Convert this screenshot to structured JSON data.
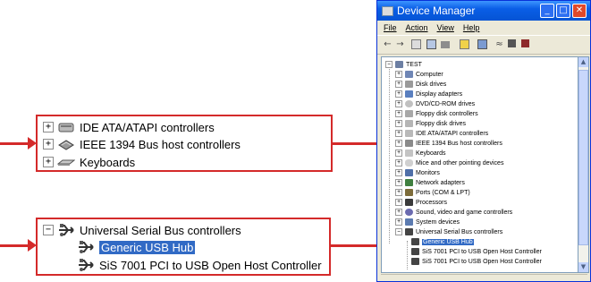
{
  "zoom_top": {
    "rows": [
      {
        "expander": "+",
        "label": "IDE ATA/ATAPI controllers",
        "icon": "ide-controller-icon"
      },
      {
        "expander": "+",
        "label": "IEEE 1394 Bus host controllers",
        "icon": "ieee1394-icon"
      },
      {
        "expander": "+",
        "label": "Keyboards",
        "icon": "keyboard-icon"
      }
    ]
  },
  "zoom_bottom": {
    "parent": {
      "expander": "−",
      "label": "Universal Serial Bus controllers",
      "icon": "usb-icon"
    },
    "children": [
      {
        "label": "Generic USB Hub",
        "icon": "usb-icon",
        "selected": true
      },
      {
        "label": "SiS 7001 PCI to USB Open Host Controller",
        "icon": "usb-icon",
        "selected": false
      }
    ]
  },
  "window": {
    "title": "Device Manager",
    "controls": {
      "minimize": "_",
      "maximize": "□",
      "close": "✕"
    },
    "menu": [
      "File",
      "Action",
      "View",
      "Help"
    ],
    "toolbar_icons": [
      "back-icon",
      "forward-icon",
      "properties-icon",
      "update-driver-icon",
      "print-icon",
      "help-icon",
      "scan-icon",
      "uninstall-icon",
      "disable-icon",
      "enable-icon"
    ],
    "tree": {
      "root": {
        "expander": "−",
        "label": "TEST",
        "icon": "computer-icon"
      },
      "items": [
        {
          "expander": "+",
          "label": "Computer"
        },
        {
          "expander": "+",
          "label": "Disk drives"
        },
        {
          "expander": "+",
          "label": "Display adapters"
        },
        {
          "expander": "+",
          "label": "DVD/CD-ROM drives"
        },
        {
          "expander": "+",
          "label": "Floppy disk controllers"
        },
        {
          "expander": "+",
          "label": "Floppy disk drives"
        },
        {
          "expander": "+",
          "label": "IDE ATA/ATAPI controllers"
        },
        {
          "expander": "+",
          "label": "IEEE 1394 Bus host controllers"
        },
        {
          "expander": "+",
          "label": "Keyboards"
        },
        {
          "expander": "+",
          "label": "Mice and other pointing devices"
        },
        {
          "expander": "+",
          "label": "Monitors"
        },
        {
          "expander": "+",
          "label": "Network adapters"
        },
        {
          "expander": "+",
          "label": "Ports (COM & LPT)"
        },
        {
          "expander": "+",
          "label": "Processors"
        },
        {
          "expander": "+",
          "label": "Sound, video and game controllers"
        },
        {
          "expander": "+",
          "label": "System devices"
        },
        {
          "expander": "−",
          "label": "Universal Serial Bus controllers"
        }
      ],
      "usb_children": [
        {
          "label": "Generic USB Hub",
          "selected": true
        },
        {
          "label": "SiS 7001 PCI to USB Open Host Controller",
          "selected": false
        },
        {
          "label": "SiS 7001 PCI to USB Open Host Controller",
          "selected": false
        }
      ]
    }
  },
  "colors": {
    "callout_border": "#d42a2a",
    "selection": "#316ac5",
    "titlebar": "#0a5ee6",
    "window_bg": "#ece9d8"
  }
}
